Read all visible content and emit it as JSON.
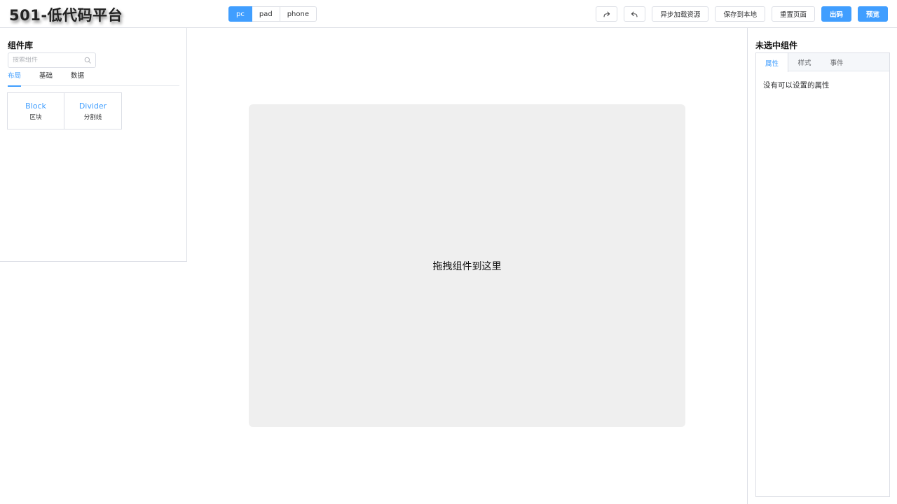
{
  "header": {
    "logo": "501-低代码平台",
    "devices": [
      "pc",
      "pad",
      "phone"
    ],
    "active_device": "pc",
    "toolbar": {
      "redo_icon": "redo-icon",
      "undo_icon": "undo-icon",
      "async_load": "异步加载资源",
      "save_local": "保存到本地",
      "reset_page": "重置页面",
      "export_code": "出码",
      "preview": "预览"
    }
  },
  "left_panel": {
    "title": "组件库",
    "search_placeholder": "搜索组件",
    "tabs": [
      "布局",
      "基础",
      "数据"
    ],
    "active_tab": "布局",
    "components": [
      {
        "name": "Block",
        "desc": "区块"
      },
      {
        "name": "Divider",
        "desc": "分割线"
      }
    ]
  },
  "canvas": {
    "hint": "拖拽组件到这里"
  },
  "right_panel": {
    "title": "未选中组件",
    "tabs": [
      "属性",
      "样式",
      "事件"
    ],
    "active_tab": "属性",
    "empty_text": "没有可以设置的属性"
  },
  "colors": {
    "primary": "#409eff",
    "border": "#dcdfe6",
    "canvas_bg": "#efefef"
  }
}
